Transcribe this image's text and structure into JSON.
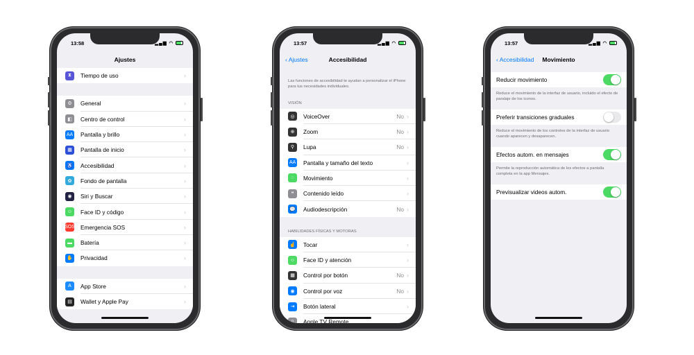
{
  "phones": [
    {
      "time": "13:58",
      "title": "Ajustes",
      "back": "",
      "groups": [
        [
          {
            "label": "Tiempo de uso",
            "icon": "hourglass-icon",
            "color": "#5856d6",
            "glyph": "⧗"
          }
        ],
        [
          {
            "label": "General",
            "icon": "gear-icon",
            "color": "#8e8e93",
            "glyph": "⚙"
          },
          {
            "label": "Centro de control",
            "icon": "toggles-icon",
            "color": "#8e8e93",
            "glyph": "◧"
          },
          {
            "label": "Pantalla y brillo",
            "icon": "text-size-icon",
            "color": "#007aff",
            "glyph": "AA"
          },
          {
            "label": "Pantalla de inicio",
            "icon": "grid-icon",
            "color": "#2c4fd8",
            "glyph": "▦"
          },
          {
            "label": "Accesibilidad",
            "icon": "accessibility-icon",
            "color": "#007aff",
            "glyph": "♿"
          },
          {
            "label": "Fondo de pantalla",
            "icon": "flower-icon",
            "color": "#34aadc",
            "glyph": "✿"
          },
          {
            "label": "Siri y Buscar",
            "icon": "siri-icon",
            "color": "#222244",
            "glyph": "◉"
          },
          {
            "label": "Face ID y código",
            "icon": "face-id-icon",
            "color": "#4cd964",
            "glyph": "☺"
          },
          {
            "label": "Emergencia SOS",
            "icon": "sos-icon",
            "color": "#ff3b30",
            "glyph": "SOS"
          },
          {
            "label": "Batería",
            "icon": "battery-icon",
            "color": "#4cd964",
            "glyph": "▬"
          },
          {
            "label": "Privacidad",
            "icon": "hand-icon",
            "color": "#007aff",
            "glyph": "✋"
          }
        ],
        [
          {
            "label": "App Store",
            "icon": "app-store-icon",
            "color": "#1a8cff",
            "glyph": "A"
          },
          {
            "label": "Wallet y Apple Pay",
            "icon": "wallet-icon",
            "color": "#222",
            "glyph": "▤"
          }
        ]
      ]
    },
    {
      "time": "13:57",
      "title": "Accesibilidad",
      "back": "Ajustes",
      "intro": "Las funciones de accesibilidad te ayudan a personalizar el iPhone para tus necesidades individuales.",
      "sections": [
        {
          "header": "VISIÓN",
          "items": [
            {
              "label": "VoiceOver",
              "value": "No",
              "icon": "voiceover-icon",
              "color": "#333",
              "glyph": "◎"
            },
            {
              "label": "Zoom",
              "value": "No",
              "icon": "zoom-icon",
              "color": "#333",
              "glyph": "⊕"
            },
            {
              "label": "Lupa",
              "value": "No",
              "icon": "magnifier-icon",
              "color": "#333",
              "glyph": "⚲"
            },
            {
              "label": "Pantalla y tamaño del texto",
              "value": "",
              "icon": "text-size-icon",
              "color": "#007aff",
              "glyph": "AA"
            },
            {
              "label": "Movimiento",
              "value": "",
              "icon": "motion-icon",
              "color": "#4cd964",
              "glyph": "◌"
            },
            {
              "label": "Contenido leído",
              "value": "",
              "icon": "speech-icon",
              "color": "#8e8e93",
              "glyph": "❝"
            },
            {
              "label": "Audiodescripción",
              "value": "No",
              "icon": "audio-description-icon",
              "color": "#007aff",
              "glyph": "💬"
            }
          ]
        },
        {
          "header": "HABILIDADES FÍSICAS Y MOTORAS",
          "items": [
            {
              "label": "Tocar",
              "value": "",
              "icon": "touch-icon",
              "color": "#007aff",
              "glyph": "☝"
            },
            {
              "label": "Face ID y atención",
              "value": "",
              "icon": "face-id-icon",
              "color": "#4cd964",
              "glyph": "☺"
            },
            {
              "label": "Control por botón",
              "value": "No",
              "icon": "switch-control-icon",
              "color": "#333",
              "glyph": "▦"
            },
            {
              "label": "Control por voz",
              "value": "No",
              "icon": "voice-control-icon",
              "color": "#007aff",
              "glyph": "◉"
            },
            {
              "label": "Botón lateral",
              "value": "",
              "icon": "side-button-icon",
              "color": "#007aff",
              "glyph": "⇥"
            },
            {
              "label": "Apple TV Remote",
              "value": "",
              "icon": "remote-icon",
              "color": "#8e8e93",
              "glyph": "▯"
            }
          ]
        }
      ]
    },
    {
      "time": "13:57",
      "title": "Movimiento",
      "back": "Accesibilidad",
      "settings": [
        {
          "label": "Reducir movimiento",
          "on": true,
          "desc": "Reduce el movimiento de la interfaz de usuario, incluido el efecto de paralaje de los iconos."
        },
        {
          "label": "Preferir transiciones graduales",
          "on": false,
          "desc": "Reduce el movimiento de los controles de la interfaz de usuario cuando aparecen y desaparecen."
        },
        {
          "label": "Efectos autom. en mensajes",
          "on": true,
          "desc": "Permite la reproducción automática de los efectos a pantalla completa en la app Mensajes."
        },
        {
          "label": "Previsualizar videos autom.",
          "on": true,
          "desc": ""
        }
      ]
    }
  ]
}
